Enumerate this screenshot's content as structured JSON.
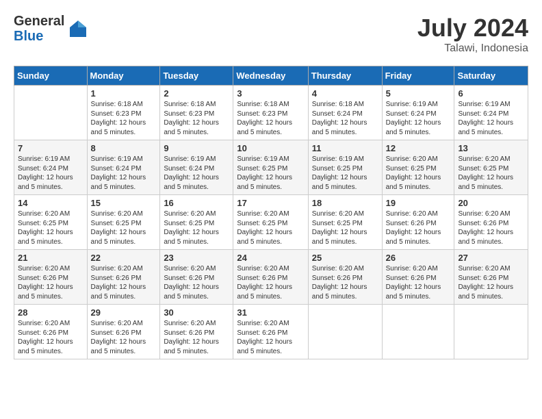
{
  "header": {
    "logo_general": "General",
    "logo_blue": "Blue",
    "month_year": "July 2024",
    "location": "Talawi, Indonesia"
  },
  "columns": [
    "Sunday",
    "Monday",
    "Tuesday",
    "Wednesday",
    "Thursday",
    "Friday",
    "Saturday"
  ],
  "weeks": [
    [
      {
        "day": "",
        "sunrise": "",
        "sunset": "",
        "daylight": ""
      },
      {
        "day": "1",
        "sunrise": "Sunrise: 6:18 AM",
        "sunset": "Sunset: 6:23 PM",
        "daylight": "Daylight: 12 hours and 5 minutes."
      },
      {
        "day": "2",
        "sunrise": "Sunrise: 6:18 AM",
        "sunset": "Sunset: 6:23 PM",
        "daylight": "Daylight: 12 hours and 5 minutes."
      },
      {
        "day": "3",
        "sunrise": "Sunrise: 6:18 AM",
        "sunset": "Sunset: 6:23 PM",
        "daylight": "Daylight: 12 hours and 5 minutes."
      },
      {
        "day": "4",
        "sunrise": "Sunrise: 6:18 AM",
        "sunset": "Sunset: 6:24 PM",
        "daylight": "Daylight: 12 hours and 5 minutes."
      },
      {
        "day": "5",
        "sunrise": "Sunrise: 6:19 AM",
        "sunset": "Sunset: 6:24 PM",
        "daylight": "Daylight: 12 hours and 5 minutes."
      },
      {
        "day": "6",
        "sunrise": "Sunrise: 6:19 AM",
        "sunset": "Sunset: 6:24 PM",
        "daylight": "Daylight: 12 hours and 5 minutes."
      }
    ],
    [
      {
        "day": "7",
        "sunrise": "Sunrise: 6:19 AM",
        "sunset": "Sunset: 6:24 PM",
        "daylight": "Daylight: 12 hours and 5 minutes."
      },
      {
        "day": "8",
        "sunrise": "Sunrise: 6:19 AM",
        "sunset": "Sunset: 6:24 PM",
        "daylight": "Daylight: 12 hours and 5 minutes."
      },
      {
        "day": "9",
        "sunrise": "Sunrise: 6:19 AM",
        "sunset": "Sunset: 6:24 PM",
        "daylight": "Daylight: 12 hours and 5 minutes."
      },
      {
        "day": "10",
        "sunrise": "Sunrise: 6:19 AM",
        "sunset": "Sunset: 6:25 PM",
        "daylight": "Daylight: 12 hours and 5 minutes."
      },
      {
        "day": "11",
        "sunrise": "Sunrise: 6:19 AM",
        "sunset": "Sunset: 6:25 PM",
        "daylight": "Daylight: 12 hours and 5 minutes."
      },
      {
        "day": "12",
        "sunrise": "Sunrise: 6:20 AM",
        "sunset": "Sunset: 6:25 PM",
        "daylight": "Daylight: 12 hours and 5 minutes."
      },
      {
        "day": "13",
        "sunrise": "Sunrise: 6:20 AM",
        "sunset": "Sunset: 6:25 PM",
        "daylight": "Daylight: 12 hours and 5 minutes."
      }
    ],
    [
      {
        "day": "14",
        "sunrise": "Sunrise: 6:20 AM",
        "sunset": "Sunset: 6:25 PM",
        "daylight": "Daylight: 12 hours and 5 minutes."
      },
      {
        "day": "15",
        "sunrise": "Sunrise: 6:20 AM",
        "sunset": "Sunset: 6:25 PM",
        "daylight": "Daylight: 12 hours and 5 minutes."
      },
      {
        "day": "16",
        "sunrise": "Sunrise: 6:20 AM",
        "sunset": "Sunset: 6:25 PM",
        "daylight": "Daylight: 12 hours and 5 minutes."
      },
      {
        "day": "17",
        "sunrise": "Sunrise: 6:20 AM",
        "sunset": "Sunset: 6:25 PM",
        "daylight": "Daylight: 12 hours and 5 minutes."
      },
      {
        "day": "18",
        "sunrise": "Sunrise: 6:20 AM",
        "sunset": "Sunset: 6:25 PM",
        "daylight": "Daylight: 12 hours and 5 minutes."
      },
      {
        "day": "19",
        "sunrise": "Sunrise: 6:20 AM",
        "sunset": "Sunset: 6:26 PM",
        "daylight": "Daylight: 12 hours and 5 minutes."
      },
      {
        "day": "20",
        "sunrise": "Sunrise: 6:20 AM",
        "sunset": "Sunset: 6:26 PM",
        "daylight": "Daylight: 12 hours and 5 minutes."
      }
    ],
    [
      {
        "day": "21",
        "sunrise": "Sunrise: 6:20 AM",
        "sunset": "Sunset: 6:26 PM",
        "daylight": "Daylight: 12 hours and 5 minutes."
      },
      {
        "day": "22",
        "sunrise": "Sunrise: 6:20 AM",
        "sunset": "Sunset: 6:26 PM",
        "daylight": "Daylight: 12 hours and 5 minutes."
      },
      {
        "day": "23",
        "sunrise": "Sunrise: 6:20 AM",
        "sunset": "Sunset: 6:26 PM",
        "daylight": "Daylight: 12 hours and 5 minutes."
      },
      {
        "day": "24",
        "sunrise": "Sunrise: 6:20 AM",
        "sunset": "Sunset: 6:26 PM",
        "daylight": "Daylight: 12 hours and 5 minutes."
      },
      {
        "day": "25",
        "sunrise": "Sunrise: 6:20 AM",
        "sunset": "Sunset: 6:26 PM",
        "daylight": "Daylight: 12 hours and 5 minutes."
      },
      {
        "day": "26",
        "sunrise": "Sunrise: 6:20 AM",
        "sunset": "Sunset: 6:26 PM",
        "daylight": "Daylight: 12 hours and 5 minutes."
      },
      {
        "day": "27",
        "sunrise": "Sunrise: 6:20 AM",
        "sunset": "Sunset: 6:26 PM",
        "daylight": "Daylight: 12 hours and 5 minutes."
      }
    ],
    [
      {
        "day": "28",
        "sunrise": "Sunrise: 6:20 AM",
        "sunset": "Sunset: 6:26 PM",
        "daylight": "Daylight: 12 hours and 5 minutes."
      },
      {
        "day": "29",
        "sunrise": "Sunrise: 6:20 AM",
        "sunset": "Sunset: 6:26 PM",
        "daylight": "Daylight: 12 hours and 5 minutes."
      },
      {
        "day": "30",
        "sunrise": "Sunrise: 6:20 AM",
        "sunset": "Sunset: 6:26 PM",
        "daylight": "Daylight: 12 hours and 5 minutes."
      },
      {
        "day": "31",
        "sunrise": "Sunrise: 6:20 AM",
        "sunset": "Sunset: 6:26 PM",
        "daylight": "Daylight: 12 hours and 5 minutes."
      },
      {
        "day": "",
        "sunrise": "",
        "sunset": "",
        "daylight": ""
      },
      {
        "day": "",
        "sunrise": "",
        "sunset": "",
        "daylight": ""
      },
      {
        "day": "",
        "sunrise": "",
        "sunset": "",
        "daylight": ""
      }
    ]
  ]
}
